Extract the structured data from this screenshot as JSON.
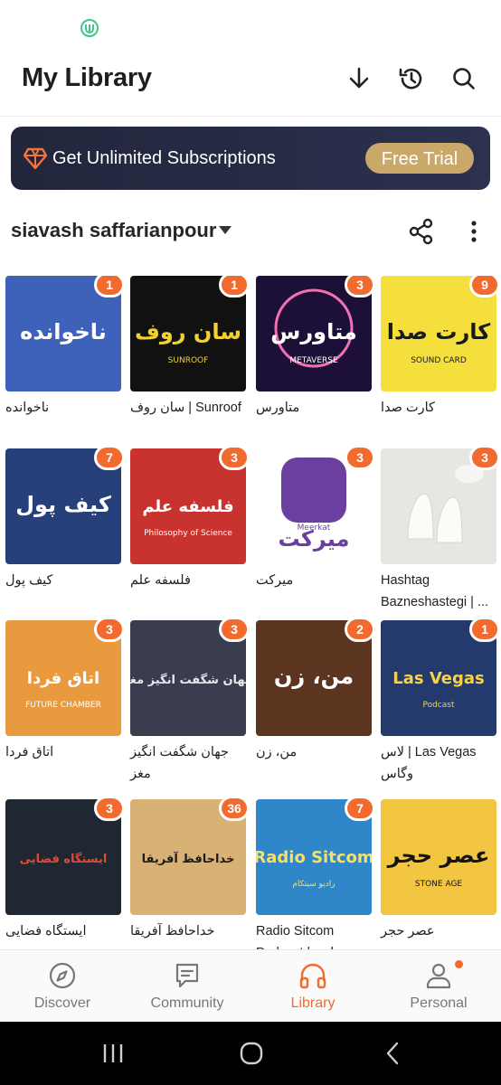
{
  "header": {
    "title": "My Library"
  },
  "promo": {
    "text": "Get Unlimited Subscriptions",
    "button": "Free Trial"
  },
  "owner": {
    "name": "siavash saffarianpour"
  },
  "podcasts": [
    {
      "title": "ناخوانده",
      "badge": "1",
      "rtl": true
    },
    {
      "title": "Sunroof | سان روف",
      "badge": "1",
      "rtl": true
    },
    {
      "title": "متاورس",
      "badge": "3",
      "rtl": true
    },
    {
      "title": "کارت صدا",
      "badge": "9",
      "rtl": true
    },
    {
      "title": "کیف پول",
      "badge": "7",
      "rtl": true
    },
    {
      "title": "فلسفه علم",
      "badge": "3",
      "rtl": true
    },
    {
      "title": "میرکت",
      "badge": "3",
      "rtl": true
    },
    {
      "title": "Hashtag Bazneshastegi | ...",
      "badge": "3",
      "rtl": false
    },
    {
      "title": "اتاق فردا",
      "badge": "3",
      "rtl": true
    },
    {
      "title": "جهان شگفت انگیز مغز",
      "badge": "3",
      "rtl": true
    },
    {
      "title": "من، زن",
      "badge": "2",
      "rtl": true
    },
    {
      "title": "Las Vegas | لاس وگاس",
      "badge": "1",
      "rtl": true
    },
    {
      "title": "ایستگاه فضایی",
      "badge": "3",
      "rtl": true
    },
    {
      "title": "خداحافظ آفریقا",
      "badge": "36",
      "rtl": true
    },
    {
      "title": "Radio Sitcom Podcast | رادیو سیتکام",
      "badge": "7",
      "rtl": false
    },
    {
      "title": "عصر حجر",
      "badge": "",
      "rtl": true
    }
  ],
  "covers": [
    {
      "bg": "#3e62b9",
      "fg": "#ffffff",
      "text": "ناخوانده"
    },
    {
      "bg": "#111111",
      "fg": "#f2d230",
      "text": "سان روف",
      "small": "SUNROOF"
    },
    {
      "bg": "#1d1038",
      "fg": "#ffffff",
      "text": "متاورس",
      "small": "METAVERSE"
    },
    {
      "bg": "#f4df3c",
      "fg": "#1a1a1a",
      "text": "کارت صدا",
      "small": "SOUND CARD"
    },
    {
      "bg": "#27407a",
      "fg": "#ffffff",
      "text": "کیف پول"
    },
    {
      "bg": "#c8332f",
      "fg": "#ffffff",
      "text": "فلسفه علم",
      "small": "Philosophy of Science"
    },
    {
      "bg": "#ffffff",
      "fg": "#6a3fa0",
      "text": "میرکت",
      "small": "Meerkat"
    },
    {
      "bg": "#e8e6e3",
      "fg": "#9c9892",
      "text": ""
    },
    {
      "bg": "#ea9a3e",
      "fg": "#ffffff",
      "text": "اتاق فردا",
      "small": "FUTURE CHAMBER"
    },
    {
      "bg": "#3a3d4d",
      "fg": "#e8e8ef",
      "text": "جهان شگفت انگیز مغز"
    },
    {
      "bg": "#5b3520",
      "fg": "#ffffff",
      "text": "من، زن"
    },
    {
      "bg": "#243a6c",
      "fg": "#f6d346",
      "text": "Las Vegas",
      "small": "Podcast"
    },
    {
      "bg": "#1f2733",
      "fg": "#e04a3a",
      "text": "ایستگاه فضایی"
    },
    {
      "bg": "#d8b274",
      "fg": "#1b1b1b",
      "text": "خداحافظ آفریقا"
    },
    {
      "bg": "#2f86c9",
      "fg": "#f4e16b",
      "text": "Radio Sitcom",
      "small": "رادیو سیتکام"
    },
    {
      "bg": "#f2c640",
      "fg": "#141414",
      "text": "عصر حجر",
      "small": "STONE AGE"
    }
  ],
  "nav": [
    {
      "label": "Discover",
      "icon": "compass-icon"
    },
    {
      "label": "Community",
      "icon": "chat-icon"
    },
    {
      "label": "Library",
      "icon": "headphones-icon"
    },
    {
      "label": "Personal",
      "icon": "person-icon"
    }
  ],
  "colors": {
    "accent": "#f26a2d",
    "promo_bg": "#252a42",
    "promo_button": "#c9a86a"
  }
}
